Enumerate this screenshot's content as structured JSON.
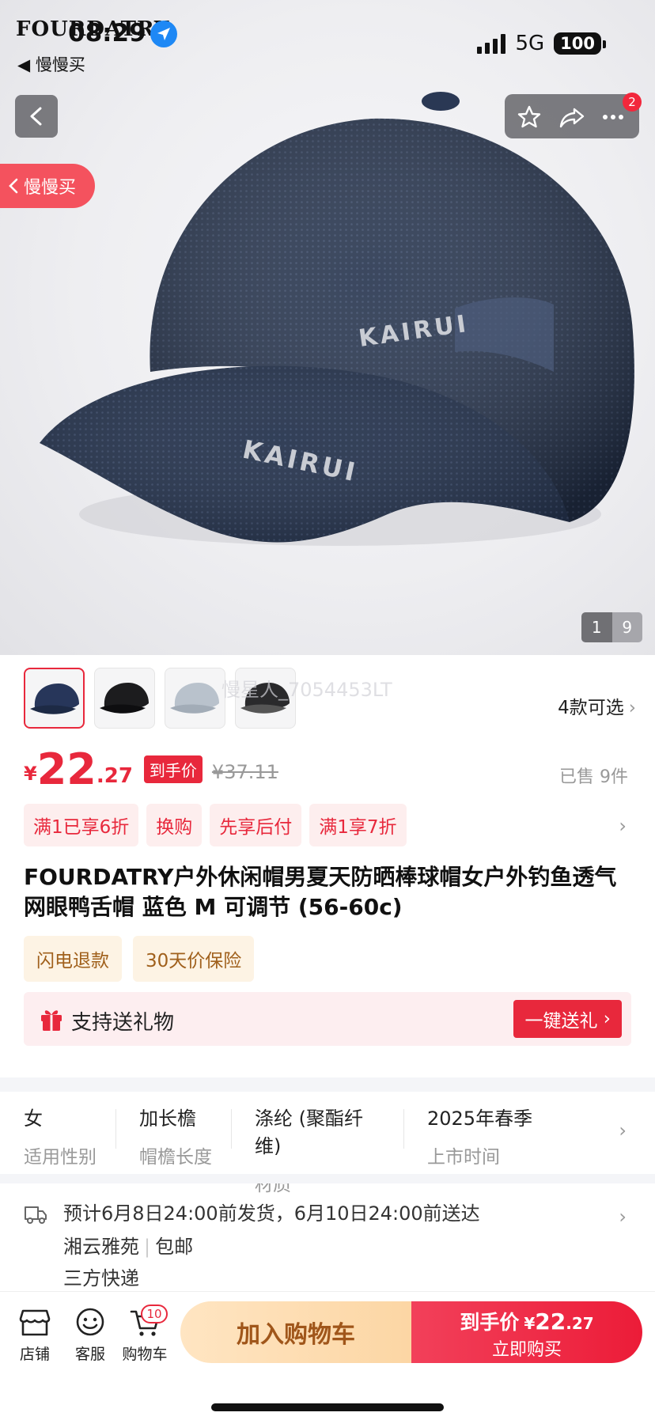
{
  "status_bar": {
    "time": "08:29",
    "network": "5G",
    "battery": "100",
    "back_app": "◀ 慢慢买"
  },
  "watermark": {
    "brand": "FOURDATRY",
    "user": "慢星人_7054453LT"
  },
  "top_bar": {
    "message_badge": "2",
    "side_pill": "慢慢买"
  },
  "gallery": {
    "current": "1",
    "total": "9"
  },
  "variants": {
    "label": "4款可选",
    "thumbnail_colors": [
      "navy",
      "black",
      "light-gray",
      "black-gray"
    ]
  },
  "price": {
    "currency": "¥",
    "integer": "22",
    "decimal": ".27",
    "tag": "到手价",
    "original": "¥37.11",
    "sold": "已售 9件"
  },
  "promos": [
    "满1已享6折",
    "换购",
    "先享后付",
    "满1享7折"
  ],
  "title": "FOURDATRY户外休闲帽男夏天防晒棒球帽女户外钓鱼透气网眼鸭舌帽 蓝色 M 可调节 (56-60c)",
  "services": [
    "闪电退款",
    "30天价保险"
  ],
  "gift": {
    "text": "支持送礼物",
    "button": "一键送礼"
  },
  "attributes": [
    {
      "value": "女",
      "key": "适用性别"
    },
    {
      "value": "加长檐",
      "key": "帽檐长度"
    },
    {
      "value": "涤纶 (聚酯纤维)",
      "key": "材质"
    },
    {
      "value": "2025年春季",
      "key": "上市时间"
    }
  ],
  "delivery": {
    "line1": "预计6月8日24:00前发货，6月10日24:00前送达",
    "origin": "湘云雅苑",
    "shipping": "包邮",
    "courier": "三方快递"
  },
  "bottom_bar": {
    "shop": "店铺",
    "service": "客服",
    "cart": "购物车",
    "cart_count": "10",
    "add_to_cart": "加入购物车",
    "buy_line1_prefix": "到手价",
    "buy_currency": "¥",
    "buy_int": "22",
    "buy_dec": ".27",
    "buy_line2": "立即购买"
  },
  "colors": {
    "accent_red": "#e8283c",
    "cap_navy": "#26344f",
    "gold_text": "#a0561a"
  }
}
